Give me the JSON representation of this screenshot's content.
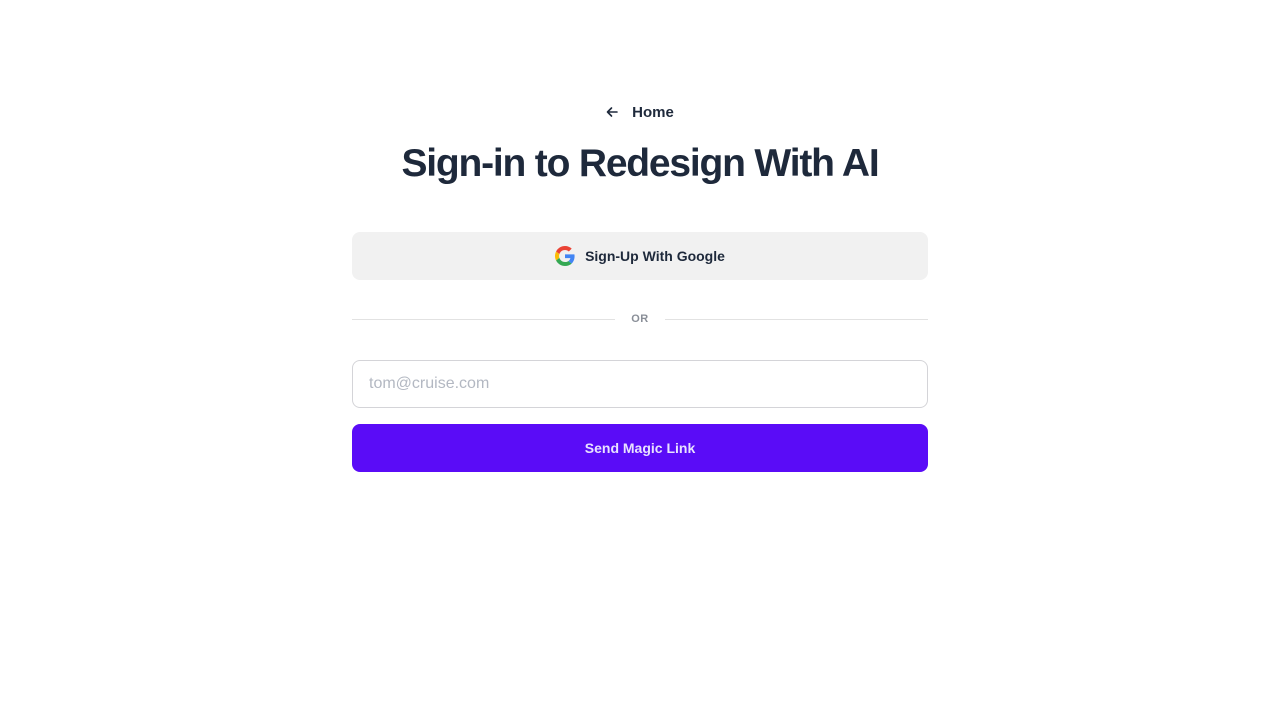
{
  "nav": {
    "back_icon": "arrow-left-icon",
    "home_label": "Home"
  },
  "page": {
    "title": "Sign-in to Redesign With AI"
  },
  "google": {
    "icon": "google-icon",
    "label": "Sign-Up With Google"
  },
  "divider": {
    "label": "OR"
  },
  "email": {
    "value": "",
    "placeholder": "tom@cruise.com"
  },
  "submit": {
    "label": "Send Magic Link"
  },
  "colors": {
    "primary": "#5a0cf7",
    "heading": "#1e293b",
    "google_button_bg": "#f1f1f1"
  }
}
